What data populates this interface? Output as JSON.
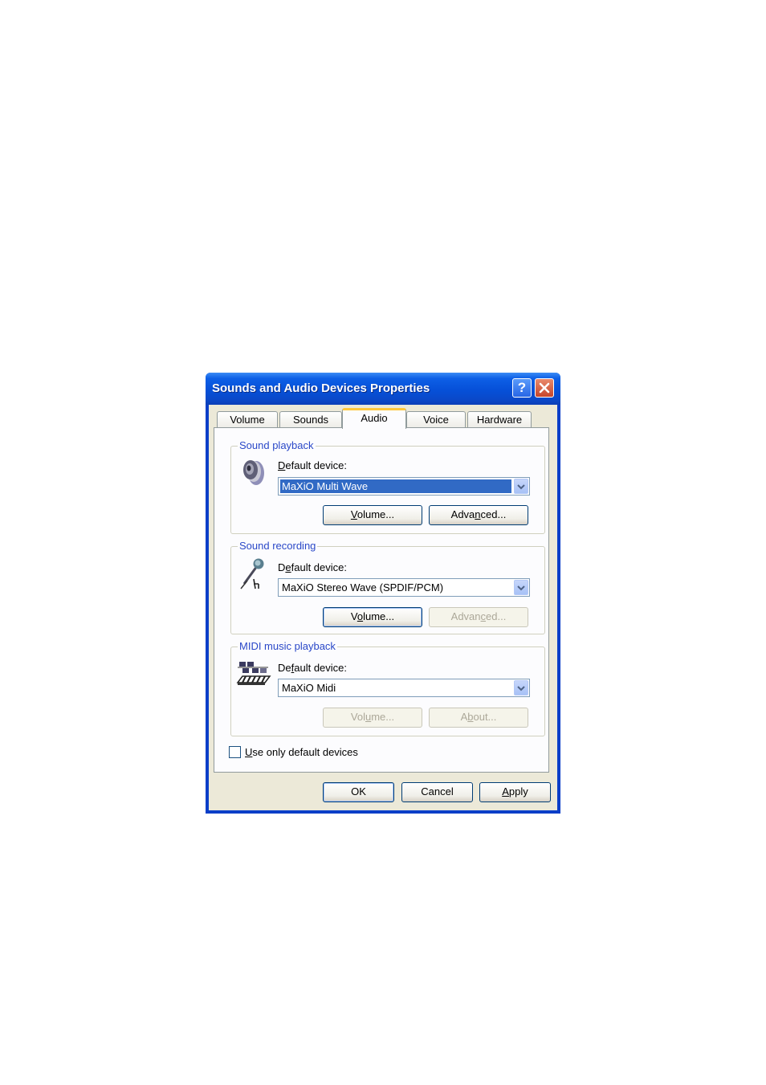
{
  "window": {
    "title": "Sounds and Audio Devices Properties",
    "help_label": "?",
    "close_icon": "close-icon"
  },
  "tabs": [
    {
      "label": "Volume",
      "active": false
    },
    {
      "label": "Sounds",
      "active": false
    },
    {
      "label": "Audio",
      "active": true
    },
    {
      "label": "Voice",
      "active": false
    },
    {
      "label": "Hardware",
      "active": false
    }
  ],
  "playback": {
    "group_label": "Sound playback",
    "icon": "speaker-icon",
    "device_label_prefix": "D",
    "device_label_rest": "efault device:",
    "device_value": "MaXiO Multi Wave",
    "volume_u": "V",
    "volume_rest": "olume...",
    "advanced_pre": "Adva",
    "advanced_u": "n",
    "advanced_post": "ced..."
  },
  "recording": {
    "group_label": "Sound recording",
    "icon": "microphone-icon",
    "device_label_pre": "D",
    "device_label_u": "e",
    "device_label_post": "fault device:",
    "device_value": "MaXiO Stereo Wave (SPDIF/PCM)",
    "volume_pre": "V",
    "volume_u": "o",
    "volume_post": "lume...",
    "advanced_pre": "Advan",
    "advanced_u": "c",
    "advanced_post": "ed..."
  },
  "midi": {
    "group_label": "MIDI music playback",
    "icon": "midi-keyboard-icon",
    "device_label_pre": "De",
    "device_label_u": "f",
    "device_label_post": "ault device:",
    "device_value": "MaXiO Midi",
    "volume_pre": "Vol",
    "volume_u": "u",
    "volume_post": "me...",
    "about_pre": "A",
    "about_u": "b",
    "about_post": "out..."
  },
  "checkbox": {
    "checked": false,
    "label_u": "U",
    "label_rest": "se only default devices"
  },
  "buttons": {
    "ok": "OK",
    "cancel": "Cancel",
    "apply_u": "A",
    "apply_rest": "pply"
  },
  "colors": {
    "title_bar": "#0650d8",
    "group_label": "#2a48c8",
    "selection": "#316ac5",
    "active_tab_accent": "#ffc83c"
  }
}
